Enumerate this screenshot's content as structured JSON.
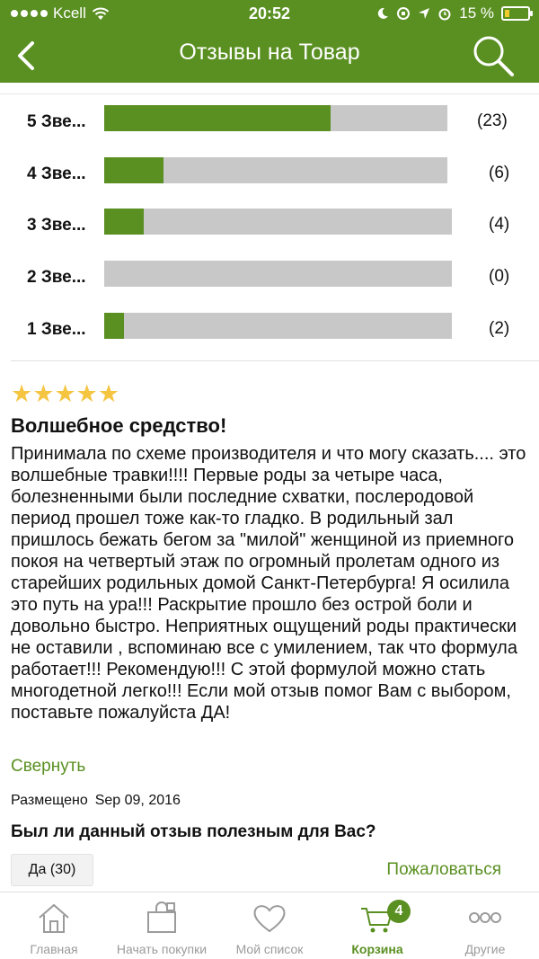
{
  "status_bar": {
    "carrier": "Kcell",
    "time": "20:52",
    "battery": "15 %"
  },
  "header": {
    "title": "Отзывы на Товар"
  },
  "rating_breakdown": [
    {
      "label": "5 Зве...",
      "count": "(23)",
      "fraction": 0.659
    },
    {
      "label": "4 Зве...",
      "count": "(6)",
      "fraction": 0.172
    },
    {
      "label": "3 Зве...",
      "count": "(4)",
      "fraction": 0.114
    },
    {
      "label": "2 Зве...",
      "count": "(0)",
      "fraction": 0.0
    },
    {
      "label": "1 Зве...",
      "count": "(2)",
      "fraction": 0.057
    }
  ],
  "review": {
    "stars": 5,
    "title": "Волшебное средство!",
    "text": "Принимала по схеме производителя и что могу сказать.... это волшебные травки!!!! Первые роды  за четыре часа, болезненными были последние схватки, послеродовой период прошел тоже как-то гладко. В родильный зал пришлось бежать бегом за \"милой\" женщиной из приемного покоя на четвертый этаж по огромный пролетам одного из старейших родильных домой Санкт-Петербурга! Я осилила это путь на ура!!! Раскрытие прошло без острой боли и довольно быстро. Неприятных ощущений роды практически не оставили , вспоминаю все с умилением, так что формула работает!!! Рекомендую!!! С этой формулой можно стать многодетной легко!!! Если мой отзыв помог Вам с выбором, поставьте пожалуйста ДА!",
    "collapse_label": "Свернуть",
    "posted_label": "Размещено",
    "posted_date": "Sep 09, 2016",
    "helpful_question": "Был ли данный отзыв полезным для Вас?",
    "yes_label": "Да (30)",
    "report_label": "Пожаловаться"
  },
  "tabbar": {
    "tabs": [
      {
        "label": "Главная",
        "icon": "home-icon"
      },
      {
        "label": "Начать покупки",
        "icon": "shopping-bag-icon"
      },
      {
        "label": "Мой список",
        "icon": "heart-icon"
      },
      {
        "label": "Корзина",
        "icon": "cart-icon",
        "badge": "4",
        "active": true
      },
      {
        "label": "Другие",
        "icon": "more-icon"
      }
    ]
  },
  "colors": {
    "brand_green": "#5a9022",
    "bar_gray": "#c8c8c8",
    "star_yellow": "#f5c542"
  }
}
